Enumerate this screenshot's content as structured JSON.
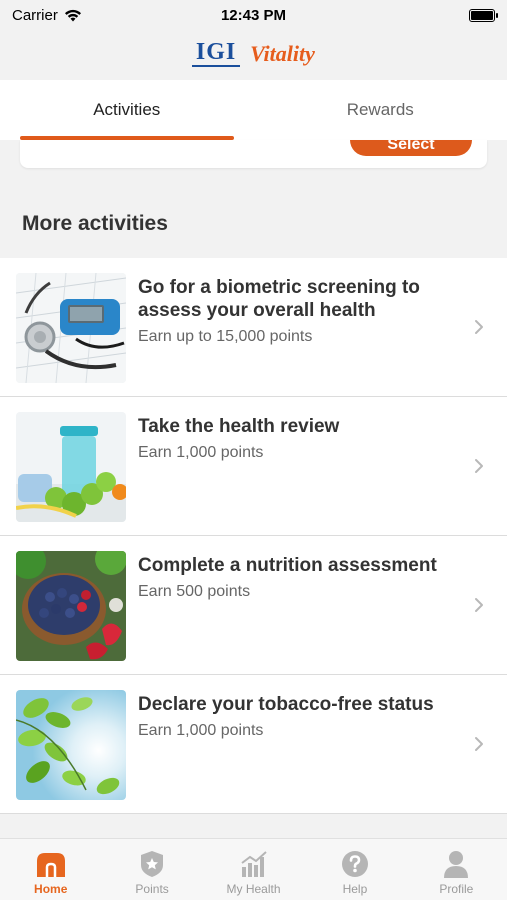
{
  "status": {
    "carrier": "Carrier",
    "time": "12:43 PM"
  },
  "brand": {
    "igi_logo": "IGI",
    "vitality_logo": "Vitality"
  },
  "tabs": [
    {
      "label": "Activities",
      "active": true
    },
    {
      "label": "Rewards",
      "active": false
    }
  ],
  "partial_card": {
    "button_label": "Select"
  },
  "section": {
    "title": "More activities"
  },
  "activities": [
    {
      "title": "Go for a biometric screening to assess your overall health",
      "subtitle": "Earn up to 15,000 points",
      "image": "glucometer-stethoscope"
    },
    {
      "title": "Take the health review",
      "subtitle": "Earn 1,000 points",
      "image": "shaker-dumbbells"
    },
    {
      "title": "Complete a nutrition assessment",
      "subtitle": "Earn 500 points",
      "image": "berries-bowl"
    },
    {
      "title": "Declare your tobacco-free status",
      "subtitle": "Earn 1,000 points",
      "image": "green-leaves-sun"
    }
  ],
  "bottom_nav": [
    {
      "label": "Home",
      "icon": "home-icon",
      "active": true
    },
    {
      "label": "Points",
      "icon": "points-badge-icon",
      "active": false
    },
    {
      "label": "My Health",
      "icon": "bar-chart-icon",
      "active": false
    },
    {
      "label": "Help",
      "icon": "help-icon",
      "active": false
    },
    {
      "label": "Profile",
      "icon": "profile-icon",
      "active": false
    }
  ],
  "colors": {
    "accent": "#e05a1a",
    "igi_blue": "#1b4f9c",
    "inactive_gray": "#9a9a9a"
  }
}
